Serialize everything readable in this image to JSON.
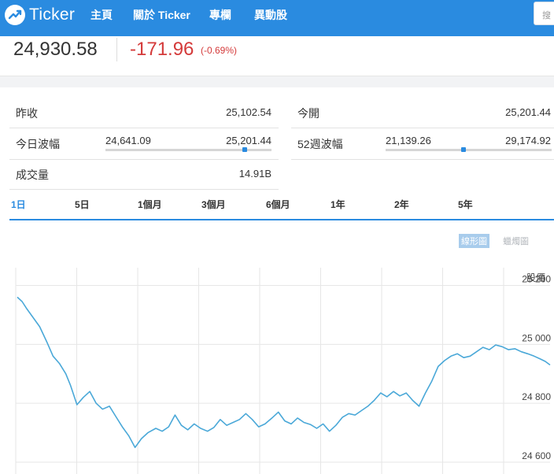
{
  "nav": {
    "logo_text": "Ticker",
    "items": [
      {
        "label": "主頁",
        "id": "home"
      },
      {
        "label": "關於 Ticker",
        "id": "about"
      },
      {
        "label": "專欄",
        "id": "columns"
      },
      {
        "label": "異動股",
        "id": "movers"
      }
    ],
    "search_placeholder": "搜"
  },
  "quote": {
    "price": "24,930.58",
    "change": "-171.96",
    "change_pct": "(-0.69%)"
  },
  "stats": {
    "prev_close_label": "昨收",
    "prev_close": "25,102.54",
    "open_label": "今開",
    "open": "25,201.44",
    "day_range_label": "今日波幅",
    "day_low": "24,641.09",
    "day_high": "25,201.44",
    "day_range_position": 0.84,
    "week52_label": "52週波幅",
    "week52_low": "21,139.26",
    "week52_high": "29,174.92",
    "week52_position": 0.47,
    "volume_label": "成交量",
    "volume": "14.91B"
  },
  "tabs": [
    {
      "label": "1日",
      "active": true
    },
    {
      "label": "5日",
      "active": false
    },
    {
      "label": "1個月",
      "active": false
    },
    {
      "label": "3個月",
      "active": false
    },
    {
      "label": "6個月",
      "active": false
    },
    {
      "label": "1年",
      "active": false
    },
    {
      "label": "2年",
      "active": false
    },
    {
      "label": "5年",
      "active": false
    }
  ],
  "chart_toggle": {
    "line_label": "線形圖",
    "candle_label": "蠟燭圖"
  },
  "colors": {
    "brand": "#2a8be0",
    "negative": "#d43a3a",
    "line": "#4aa8d8"
  },
  "chart_data": {
    "type": "line",
    "ylabel": "股價",
    "yticks": [
      24600,
      24800,
      25000,
      25200
    ],
    "ytick_labels": [
      "24 600",
      "24 800",
      "25 000",
      "25 200"
    ],
    "ylim": [
      24560,
      25260
    ],
    "xlim": [
      0,
      1
    ],
    "grid": true,
    "series": [
      {
        "x": [
          0,
          0.009,
          0.018,
          0.03,
          0.042,
          0.055,
          0.067,
          0.079,
          0.091,
          0.1,
          0.112,
          0.124,
          0.136,
          0.148,
          0.16,
          0.173,
          0.185,
          0.197,
          0.209,
          0.221,
          0.233,
          0.245,
          0.26,
          0.272,
          0.284,
          0.296,
          0.308,
          0.32,
          0.332,
          0.344,
          0.357,
          0.369,
          0.381,
          0.393,
          0.405,
          0.417,
          0.429,
          0.441,
          0.453,
          0.465,
          0.478,
          0.49,
          0.502,
          0.514,
          0.526,
          0.538,
          0.55,
          0.562,
          0.574,
          0.586,
          0.598,
          0.61,
          0.622,
          0.634,
          0.646,
          0.658,
          0.67,
          0.682,
          0.694,
          0.706,
          0.718,
          0.73,
          0.742,
          0.754,
          0.766,
          0.778,
          0.79,
          0.802,
          0.814,
          0.826,
          0.838,
          0.85,
          0.862,
          0.874,
          0.886,
          0.898,
          0.91,
          0.922,
          0.934,
          0.946,
          0.958,
          0.97,
          0.982,
          0.991,
          1
        ],
        "y": [
          25160,
          25145,
          25120,
          25090,
          25060,
          25010,
          24960,
          24935,
          24900,
          24860,
          24795,
          24820,
          24840,
          24800,
          24780,
          24790,
          24755,
          24720,
          24690,
          24650,
          24680,
          24700,
          24715,
          24705,
          24720,
          24760,
          24725,
          24710,
          24730,
          24715,
          24705,
          24718,
          24745,
          24725,
          24735,
          24745,
          24765,
          24745,
          24720,
          24730,
          24750,
          24770,
          24740,
          24730,
          24750,
          24735,
          24728,
          24715,
          24730,
          24705,
          24725,
          24752,
          24765,
          24760,
          24775,
          24790,
          24810,
          24835,
          24822,
          24840,
          24825,
          24835,
          24810,
          24790,
          24835,
          24875,
          24925,
          24945,
          24960,
          24968,
          24955,
          24960,
          24975,
          24990,
          24982,
          24998,
          24992,
          24982,
          24985,
          24975,
          24968,
          24960,
          24950,
          24942,
          24930
        ]
      }
    ]
  }
}
